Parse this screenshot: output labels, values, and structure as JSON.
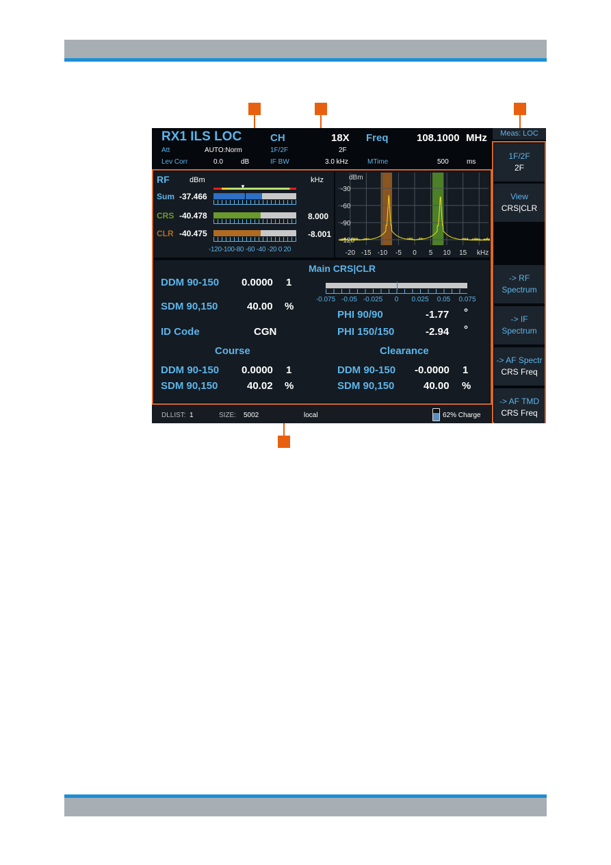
{
  "header": {
    "title": "RX1 ILS LOC",
    "ch_label": "CH",
    "ch_value": "18X",
    "freq_label": "Freq",
    "freq_value": "108.1000",
    "freq_unit": "MHz",
    "att_label": "Att",
    "att_value": "AUTO:Norm",
    "mode_label": "1F/2F",
    "mode_value": "2F",
    "levcorr_label": "Lev Corr",
    "levcorr_value": "0.0",
    "levcorr_unit": "dB",
    "ifbw_label": "IF BW",
    "ifbw_value": "3.0 kHz",
    "mtime_label": "MTime",
    "mtime_value": "500",
    "mtime_unit": "ms"
  },
  "rf": {
    "title": "RF",
    "unit_dbm": "dBm",
    "unit_khz": "kHz",
    "rows": [
      {
        "label": "Sum",
        "value": "-37.466",
        "khz": "",
        "color": "#2f6fc4",
        "fill": 0.59
      },
      {
        "label": "CRS",
        "value": "-40.478",
        "khz": "8.000",
        "color": "#6a9a2c",
        "fill": 0.57
      },
      {
        "label": "CLR",
        "value": "-40.475",
        "khz": "-8.001",
        "color": "#b06a22",
        "fill": 0.57
      }
    ],
    "scale": "-120-100-80 -60 -40 -20  0  20"
  },
  "spectrum": {
    "ylabel": "dBm",
    "xunit": "kHz",
    "yticks": [
      "-30",
      "-60",
      "-90",
      "-120"
    ],
    "xticks": [
      "-20",
      "-15",
      "-10",
      "-5",
      "0",
      "5",
      "10",
      "15"
    ],
    "trace_color": "#f0e020",
    "clr_band_color": "#b06a22",
    "crs_band_color": "#5a9a2a"
  },
  "main": {
    "title": "Main CRS|CLR",
    "ddm_label": "DDM  90-150",
    "ddm_value": "0.0000",
    "ddm_unit": "1",
    "sdm_label": "SDM  90,150",
    "sdm_value": "40.00",
    "sdm_unit": "%",
    "id_label": "ID  Code",
    "id_value": "CGN",
    "ddm_scale": [
      "-0.075",
      "-0.05",
      "-0.025",
      "0",
      "0.025",
      "0.05",
      "0.075"
    ],
    "phi1_label": "PHI 90/90",
    "phi1_value": "-1.77",
    "phi1_unit": "°",
    "phi2_label": "PHI 150/150",
    "phi2_value": "-2.94",
    "phi2_unit": "°"
  },
  "course": {
    "title": "Course",
    "ddm_label": "DDM  90-150",
    "ddm_value": "0.0000",
    "ddm_unit": "1",
    "sdm_label": "SDM  90,150",
    "sdm_value": "40.02",
    "sdm_unit": "%"
  },
  "clearance": {
    "title": "Clearance",
    "ddm_label": "DDM  90-150",
    "ddm_value": "-0.0000",
    "ddm_unit": "1",
    "sdm_label": "SDM  90,150",
    "sdm_value": "40.00",
    "sdm_unit": "%"
  },
  "status": {
    "dllist_label": "DLLIST:",
    "dllist_value": "1",
    "size_label": "SIZE:",
    "size_value": "5002",
    "mode": "local",
    "battery": "62% Charge",
    "battery_level": 0.62
  },
  "softkeys": {
    "title": "Meas: LOC",
    "keys": [
      {
        "label": "1F/2F",
        "value": "2F"
      },
      {
        "label": "View",
        "value": "CRS|CLR"
      },
      {
        "label": "-> RF",
        "value": "Spectrum"
      },
      {
        "label": "-> IF",
        "value": "Spectrum"
      },
      {
        "label": "-> AF Spectr",
        "value": "CRS Freq"
      },
      {
        "label": "-> AF TMD",
        "value": "CRS Freq"
      }
    ]
  }
}
